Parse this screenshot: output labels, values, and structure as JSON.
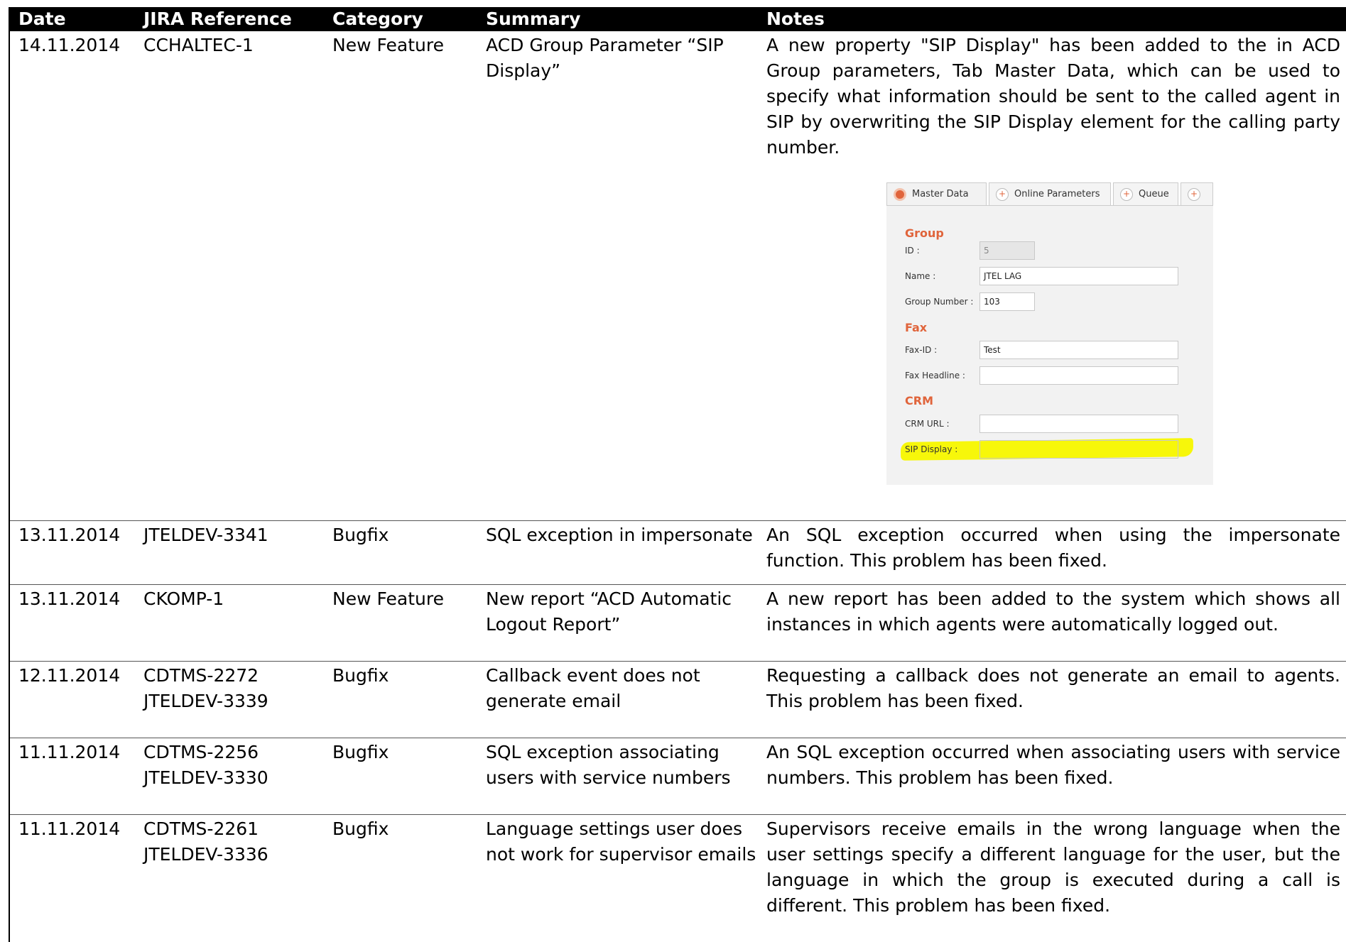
{
  "headers": {
    "date": "Date",
    "jira": "JIRA Reference",
    "category": "Category",
    "summary": "Summary",
    "notes": "Notes"
  },
  "rows": [
    {
      "date": "14.11.2014",
      "jira": [
        "CCHALTEC-1"
      ],
      "category": "New Feature",
      "summary": [
        "ACD Group Parameter “SIP",
        "Display”"
      ],
      "notes": "A new property \"SIP Display\" has been added to the in ACD Group parameters, Tab Master Data, which can be used to specify what information should be sent to the called agent in SIP by overwriting the SIP Display element for the calling party number."
    },
    {
      "date": "13.11.2014",
      "jira": [
        "JTELDEV-3341"
      ],
      "category": "Bugfix",
      "summary": [
        "SQL exception in impersonate"
      ],
      "notes": "An SQL exception occurred when using the impersonate function. This problem has been fixed."
    },
    {
      "date": "13.11.2014",
      "jira": [
        "CKOMP-1"
      ],
      "category": "New Feature",
      "summary": [
        "New report “ACD Automatic",
        "Logout Report”"
      ],
      "notes": "A new report has been added to the system which shows all instances in which agents were automatically logged out."
    },
    {
      "date": "12.11.2014",
      "jira": [
        "CDTMS-2272",
        "JTELDEV-3339"
      ],
      "category": "Bugfix",
      "summary": [
        "Callback event does not",
        "generate email"
      ],
      "notes": "Requesting a callback does not generate an email to agents. This problem has been fixed."
    },
    {
      "date": "11.11.2014",
      "jira": [
        "CDTMS-2256",
        "JTELDEV-3330"
      ],
      "category": "Bugfix",
      "summary": [
        "SQL exception associating",
        "users with service numbers"
      ],
      "notes": "An SQL exception occurred when associating users with service numbers. This problem has been fixed."
    },
    {
      "date": "11.11.2014",
      "jira": [
        "CDTMS-2261",
        "JTELDEV-3336"
      ],
      "category": "Bugfix",
      "summary": [
        "Language settings user does",
        "not work for supervisor emails"
      ],
      "notes": "Supervisors receive emails in the wrong language when the user settings specify a different language for the user, but the language in which the group is executed during a call is different. This problem has been fixed."
    }
  ],
  "screenshot": {
    "tabs": [
      "Master Data",
      "Online Parameters",
      "Queue"
    ],
    "sections": {
      "group": "Group",
      "fax": "Fax",
      "crm": "CRM"
    },
    "fields": {
      "id_label": "ID :",
      "id_value": "5",
      "name_label": "Name :",
      "name_value": "JTEL LAG",
      "group_number_label": "Group Number :",
      "group_number_value": "103",
      "fax_id_label": "Fax-ID :",
      "fax_id_value": "Test",
      "fax_headline_label": "Fax Headline :",
      "fax_headline_value": "",
      "crm_url_label": "CRM URL :",
      "crm_url_value": "",
      "sip_display_label": "SIP Display :",
      "sip_display_value": ""
    },
    "highlight_color": "#f7f70a",
    "accent_color": "#e0643b"
  }
}
